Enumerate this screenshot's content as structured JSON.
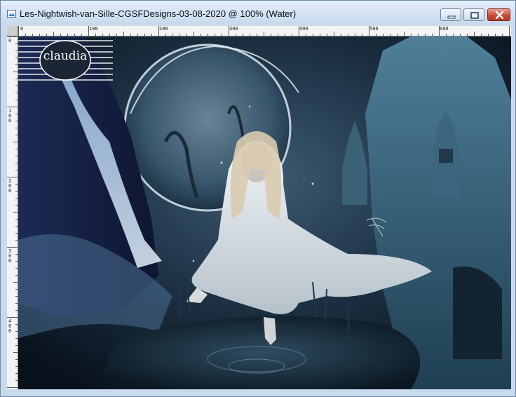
{
  "window": {
    "title": "Les-Nightwish-van-Sille-CGSFDesigns-03-08-2020 @ 100% (Water)"
  },
  "controls": {
    "minimize": "minimize-icon",
    "maximize": "maximize-icon",
    "close": "close-icon"
  },
  "ruler": {
    "top_labels": [
      "0",
      "100",
      "200",
      "300",
      "400",
      "500",
      "600"
    ],
    "left_labels": [
      "0",
      "1\n0\n0",
      "2\n0\n0",
      "3\n0\n0",
      "4\n0\n0"
    ]
  },
  "watermark": {
    "text": "claudia"
  },
  "colors": {
    "title_bar": "#d3e1f1",
    "close_button": "#c8472f",
    "canvas_dark": "#0c1622"
  }
}
